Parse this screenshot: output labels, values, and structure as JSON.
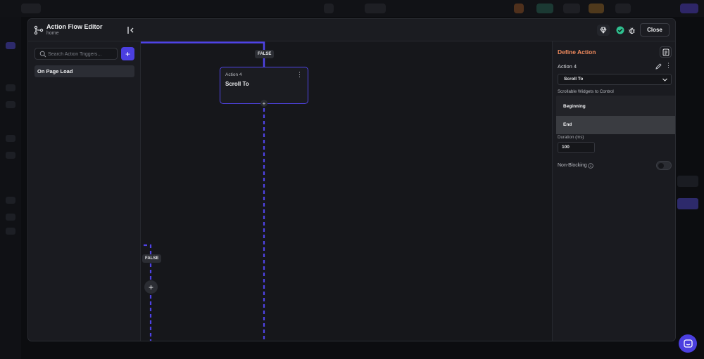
{
  "header": {
    "title": "Action Flow Editor",
    "subtitle": "home",
    "close_label": "Close",
    "icons": [
      "flow-icon",
      "collapse-panel-icon",
      "gem-icon",
      "check-circle-icon",
      "bug-icon"
    ]
  },
  "left_panel": {
    "search_placeholder": "Search Action Triggers...",
    "add_label": "+",
    "triggers": [
      {
        "label": "On Page Load",
        "selected": true
      }
    ]
  },
  "canvas": {
    "branch_labels": [
      "FALSE",
      "FALSE"
    ],
    "node": {
      "subtitle": "Action 4",
      "title": "Scroll To"
    },
    "add_label": "+",
    "node_menu": "⋮"
  },
  "right_panel": {
    "title": "Define Action",
    "action_name": "Action 4",
    "more_label": "⋮",
    "action_type": "Scroll To",
    "widgets_label": "Scrollable Widgets to Control",
    "dropdown_options": [
      {
        "label": "Beginning",
        "selected": false
      },
      {
        "label": "End",
        "selected": true
      }
    ],
    "duration_label": "Duration (ms)",
    "duration_value": "100",
    "non_blocking_label": "Non-Blocking",
    "non_blocking_on": false
  },
  "colors": {
    "accent": "#4b3fe0",
    "title_orange": "#f08a5d",
    "flow_line": "#4f43e6"
  }
}
